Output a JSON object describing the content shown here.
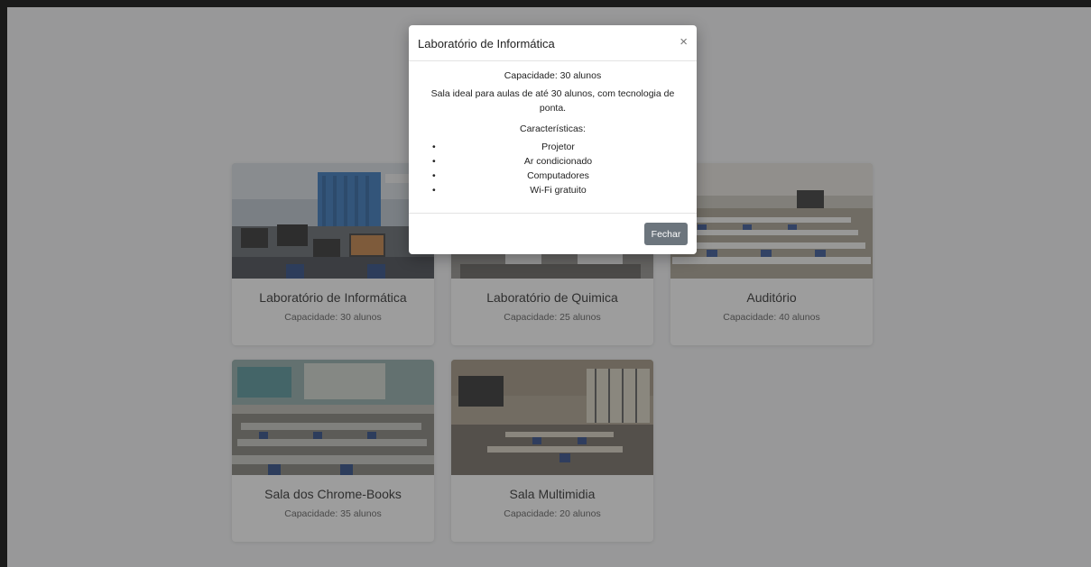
{
  "rooms": [
    {
      "name": "Laboratório de Informática",
      "capacity": "Capacidade: 30 alunos"
    },
    {
      "name": "Laboratório de Quimica",
      "capacity": "Capacidade: 25 alunos"
    },
    {
      "name": "Auditório",
      "capacity": "Capacidade: 40 alunos"
    },
    {
      "name": "Sala dos Chrome-Books",
      "capacity": "Capacidade: 35 alunos"
    },
    {
      "name": "Sala Multimidia",
      "capacity": "Capacidade: 20 alunos"
    }
  ],
  "modal": {
    "title": "Laboratório de Informática",
    "close_icon": "×",
    "capacity": "Capacidade: 30 alunos",
    "description": "Sala ideal para aulas de até 30 alunos, com tecnologia de ponta.",
    "features_title": "Características:",
    "features": [
      "Projetor",
      "Ar condicionado",
      "Computadores",
      "Wi-Fi gratuito"
    ],
    "close_button": "Fechar"
  },
  "icons": {
    "close": "close-icon",
    "photos": [
      "computer-lab-photo",
      "chemistry-lab-photo",
      "auditorium-photo",
      "chromebook-room-photo",
      "multimedia-room-photo"
    ]
  },
  "colors": {
    "page_background": "#f4f5f6",
    "backdrop": "#3c3c3c",
    "button_secondary": "#6c757d"
  }
}
